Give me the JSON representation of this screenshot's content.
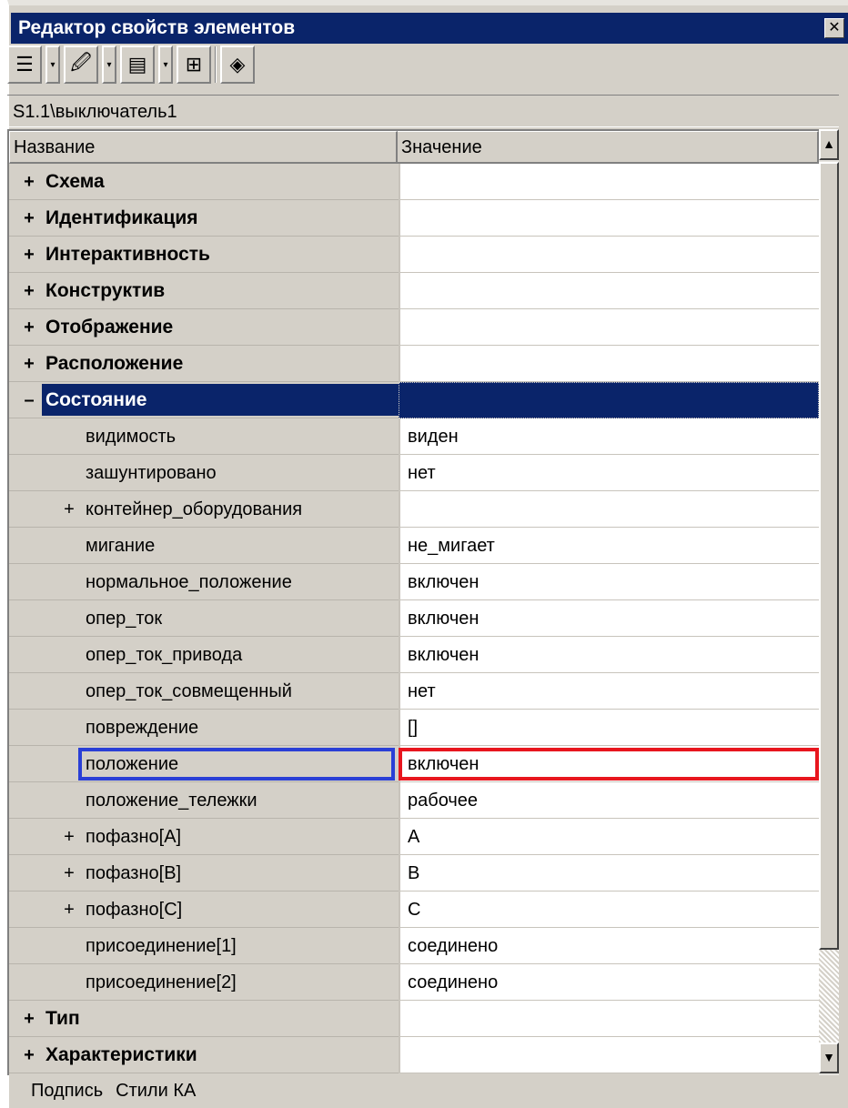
{
  "window": {
    "title": "Редактор свойств элементов",
    "close_glyph": "✕"
  },
  "toolbar": {
    "buttons": [
      {
        "icon": "properties-list-icon",
        "glyph": "☰"
      },
      {
        "icon": "object-properties-icon",
        "glyph": "🖉"
      },
      {
        "icon": "form-properties-icon",
        "glyph": "▤"
      },
      {
        "icon": "tree-add-icon",
        "glyph": "⊞"
      },
      {
        "icon": "help-book-icon",
        "glyph": "◈"
      }
    ],
    "dropdown_glyph": "▾"
  },
  "path": "S1.1\\выключатель1",
  "grid": {
    "col_name": "Название",
    "col_value": "Значение",
    "rows": [
      {
        "kind": "category",
        "expander": "+",
        "label": "Схема",
        "value": ""
      },
      {
        "kind": "category",
        "expander": "+",
        "label": "Идентификация",
        "value": ""
      },
      {
        "kind": "category",
        "expander": "+",
        "label": "Интерактивность",
        "value": ""
      },
      {
        "kind": "category",
        "expander": "+",
        "label": "Конструктив",
        "value": ""
      },
      {
        "kind": "category",
        "expander": "+",
        "label": "Отображение",
        "value": ""
      },
      {
        "kind": "category",
        "expander": "+",
        "label": "Расположение",
        "value": ""
      },
      {
        "kind": "category",
        "expander": "–",
        "label": "Состояние",
        "value": "",
        "selected": true
      },
      {
        "kind": "prop",
        "expander": "",
        "label": "видимость",
        "value": "виден"
      },
      {
        "kind": "prop",
        "expander": "",
        "label": "зашунтировано",
        "value": "нет"
      },
      {
        "kind": "prop",
        "expander": "+",
        "label": "контейнер_оборудования",
        "value": ""
      },
      {
        "kind": "prop",
        "expander": "",
        "label": "мигание",
        "value": "не_мигает"
      },
      {
        "kind": "prop",
        "expander": "",
        "label": "нормальное_положение",
        "value": "включен"
      },
      {
        "kind": "prop",
        "expander": "",
        "label": "опер_ток",
        "value": "включен"
      },
      {
        "kind": "prop",
        "expander": "",
        "label": "опер_ток_привода",
        "value": "включен"
      },
      {
        "kind": "prop",
        "expander": "",
        "label": "опер_ток_совмещенный",
        "value": "нет"
      },
      {
        "kind": "prop",
        "expander": "",
        "label": "повреждение",
        "value": "[]"
      },
      {
        "kind": "prop",
        "expander": "",
        "label": "положение",
        "value": "включен",
        "highlighted": true
      },
      {
        "kind": "prop",
        "expander": "",
        "label": "положение_тележки",
        "value": "рабочее"
      },
      {
        "kind": "prop",
        "expander": "+",
        "label": "пофазно[A]",
        "value": "A"
      },
      {
        "kind": "prop",
        "expander": "+",
        "label": "пофазно[B]",
        "value": "B"
      },
      {
        "kind": "prop",
        "expander": "+",
        "label": "пофазно[C]",
        "value": "C"
      },
      {
        "kind": "prop",
        "expander": "",
        "label": "присоединение[1]",
        "value": "соединено"
      },
      {
        "kind": "prop",
        "expander": "",
        "label": "присоединение[2]",
        "value": "соединено"
      },
      {
        "kind": "category",
        "expander": "+",
        "label": "Тип",
        "value": ""
      },
      {
        "kind": "category",
        "expander": "+",
        "label": "Характеристики",
        "value": ""
      }
    ]
  },
  "scrollbar": {
    "up_glyph": "▲",
    "down_glyph": "▼"
  },
  "status": {
    "tab1": "Подпись",
    "tab2": "Стили КА"
  },
  "colors": {
    "title_bar": "#0a246a",
    "highlight_name": "#2a3fd6",
    "highlight_value": "#e8161e"
  }
}
